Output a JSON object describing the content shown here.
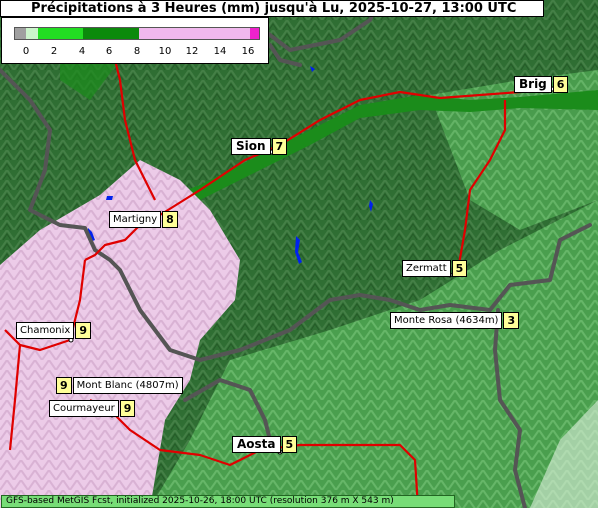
{
  "title": "Précipitations à 3 Heures (mm) jusqu'à Lu, 2025-10-27, 13:00 UTC",
  "legend": {
    "ticks": [
      "0",
      "2",
      "4",
      "6",
      "8",
      "10",
      "12",
      "14",
      "16"
    ],
    "colors": {
      "below": "#a0a0a0",
      "c0_1": "#ccf5cc",
      "c1_4": "#22dd22",
      "c4_8": "#0b8a0b",
      "c8_16": "#f1b8ee",
      "above": "#ee22cc"
    }
  },
  "colors": {
    "terrain_dark": "#2f6e33",
    "terrain_light": "#57b85a",
    "valley": "#1b8c1b",
    "precip_pink": "#f2cdee",
    "road": "#e00000",
    "border": "#555555",
    "lake": "#0022ee"
  },
  "places": [
    {
      "name": "Brig",
      "value": "6"
    },
    {
      "name": "Sion",
      "value": "7"
    },
    {
      "name": "Martigny",
      "value": "8"
    },
    {
      "name": "Zermatt",
      "value": "5"
    },
    {
      "name": "Monte Rosa (4634m)",
      "value": "3"
    },
    {
      "name": "Chamonix",
      "value": "9"
    },
    {
      "name": "Mont Blanc (4807m)",
      "value": "9"
    },
    {
      "name": "Courmayeur",
      "value": "9"
    },
    {
      "name": "Aosta",
      "value": "5"
    }
  ],
  "footer": "GFS-based MetGIS Fcst, initialized 2025-10-26, 18:00 UTC  (resolution 376 m X 543 m)"
}
